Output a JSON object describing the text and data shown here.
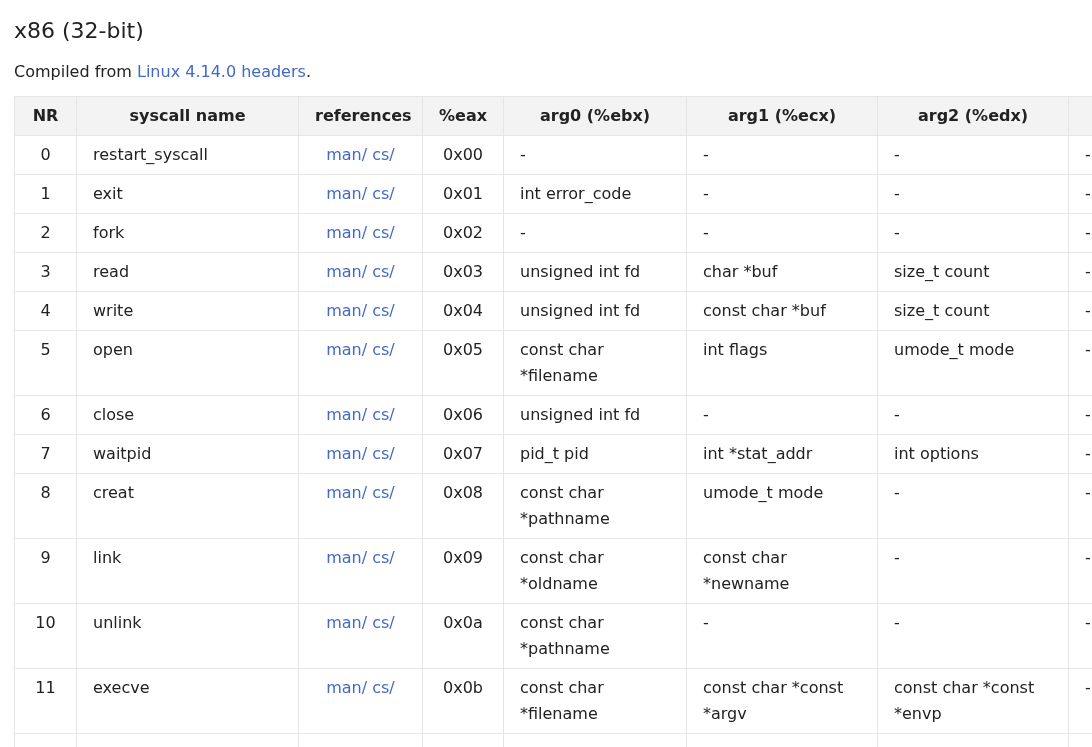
{
  "title": "x86 (32-bit)",
  "intro": {
    "before": "Compiled from ",
    "link": "Linux 4.14.0 headers",
    "after": "."
  },
  "table": {
    "columns": [
      "NR",
      "syscall name",
      "references",
      "%eax",
      "arg0 (%ebx)",
      "arg1 (%ecx)",
      "arg2 (%edx)"
    ],
    "rows": [
      {
        "nr": "0",
        "name": "restart_syscall",
        "references": [
          "man/",
          "cs/"
        ],
        "eax": "0x00",
        "arg0": "-",
        "arg1": "-",
        "arg2": "-",
        "column_8": "-"
      },
      {
        "nr": "1",
        "name": "exit",
        "references": [
          "man/",
          "cs/"
        ],
        "eax": "0x01",
        "arg0": "int error_code",
        "arg1": "-",
        "arg2": "-",
        "column_8": "-"
      },
      {
        "nr": "2",
        "name": "fork",
        "references": [
          "man/",
          "cs/"
        ],
        "eax": "0x02",
        "arg0": "-",
        "arg1": "-",
        "arg2": "-",
        "column_8": "-"
      },
      {
        "nr": "3",
        "name": "read",
        "references": [
          "man/",
          "cs/"
        ],
        "eax": "0x03",
        "arg0": "unsigned int fd",
        "arg1": "char *buf",
        "arg2": "size_t count",
        "column_8": "-"
      },
      {
        "nr": "4",
        "name": "write",
        "references": [
          "man/",
          "cs/"
        ],
        "eax": "0x04",
        "arg0": "unsigned int fd",
        "arg1": "const char *buf",
        "arg2": "size_t count",
        "column_8": "-"
      },
      {
        "nr": "5",
        "name": "open",
        "references": [
          "man/",
          "cs/"
        ],
        "eax": "0x05",
        "arg0": "const char *filename",
        "arg1": "int flags",
        "arg2": "umode_t mode",
        "column_8": "-"
      },
      {
        "nr": "6",
        "name": "close",
        "references": [
          "man/",
          "cs/"
        ],
        "eax": "0x06",
        "arg0": "unsigned int fd",
        "arg1": "-",
        "arg2": "-",
        "column_8": "-"
      },
      {
        "nr": "7",
        "name": "waitpid",
        "references": [
          "man/",
          "cs/"
        ],
        "eax": "0x07",
        "arg0": "pid_t pid",
        "arg1": "int *stat_addr",
        "arg2": "int options",
        "column_8": "-"
      },
      {
        "nr": "8",
        "name": "creat",
        "references": [
          "man/",
          "cs/"
        ],
        "eax": "0x08",
        "arg0": "const char *pathname",
        "arg1": "umode_t mode",
        "arg2": "-",
        "column_8": "-"
      },
      {
        "nr": "9",
        "name": "link",
        "references": [
          "man/",
          "cs/"
        ],
        "eax": "0x09",
        "arg0": "const char *oldname",
        "arg1": "const char *newname",
        "arg2": "-",
        "column_8": "-"
      },
      {
        "nr": "10",
        "name": "unlink",
        "references": [
          "man/",
          "cs/"
        ],
        "eax": "0x0a",
        "arg0": "const char *pathname",
        "arg1": "-",
        "arg2": "-",
        "column_8": "-"
      },
      {
        "nr": "11",
        "name": "execve",
        "references": [
          "man/",
          "cs/"
        ],
        "eax": "0x0b",
        "arg0": "const char *filename",
        "arg1": "const char *const *argv",
        "arg2": "const char *const *envp",
        "column_8": "-"
      }
    ]
  }
}
